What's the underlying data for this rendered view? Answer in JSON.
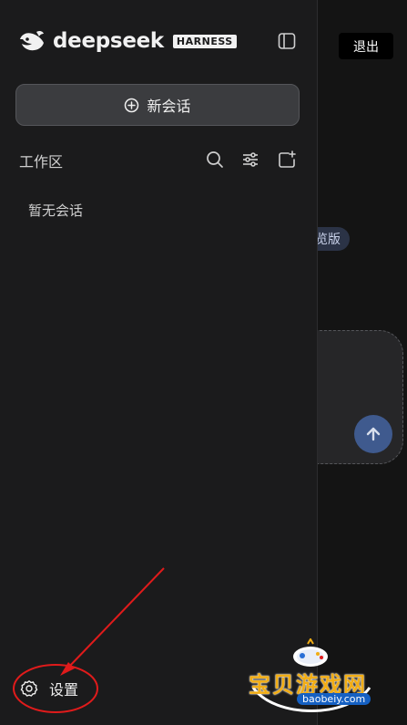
{
  "brand": {
    "name": "deepseek",
    "tag": "HARNESS"
  },
  "header": {
    "logout_label": "退出"
  },
  "main": {
    "preview_badge": "览版"
  },
  "sidebar": {
    "new_chat_label": "新会话",
    "workspace_title": "工作区",
    "empty_text": "暂无会话",
    "settings_label": "设置"
  },
  "watermark": {
    "title": "宝贝游戏网",
    "url": "baobeiy.com"
  },
  "colors": {
    "annotation": "#e01b1b",
    "send_button": "#3f5a8e",
    "brand_tag_bg": "#f1f1f1"
  },
  "icons": [
    "whale-logo-icon",
    "sidebar-toggle-icon",
    "plus-circle-icon",
    "search-icon",
    "filter-icon",
    "new-folder-icon",
    "gear-icon",
    "arrow-up-icon"
  ]
}
